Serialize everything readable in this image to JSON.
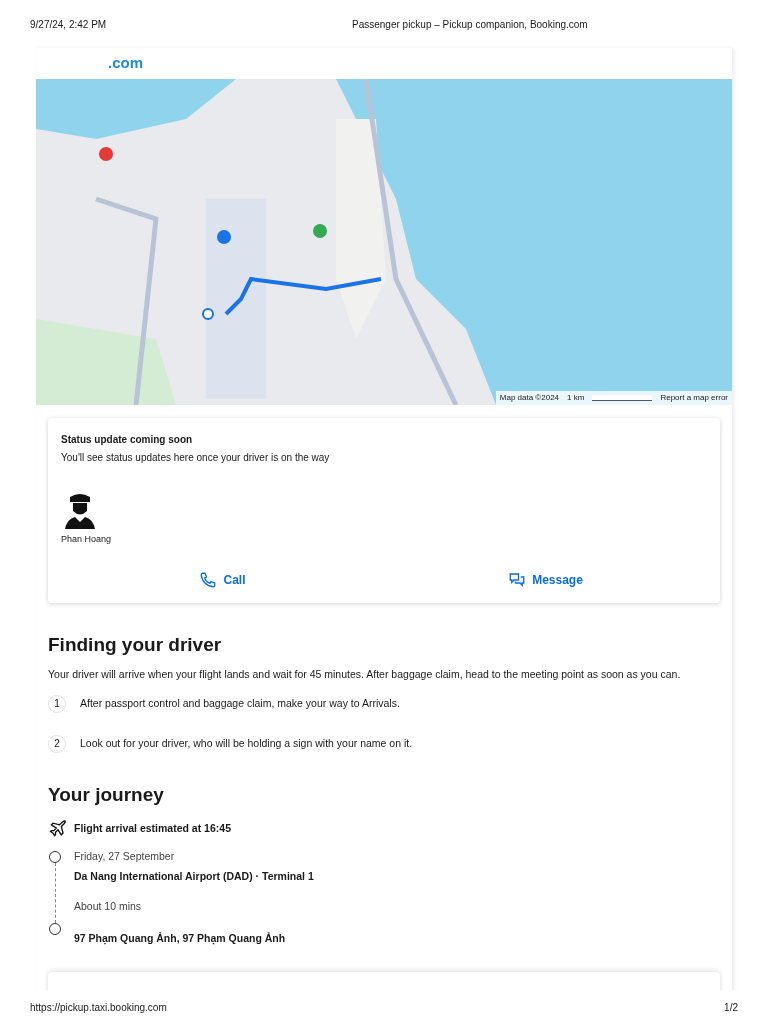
{
  "print_header": {
    "date": "9/27/24, 2:42 PM",
    "title": "Passenger pickup – Pickup companion, Booking.com"
  },
  "logo": {
    "text": ".com"
  },
  "map": {
    "kind": "picture",
    "attribution": "Map data ©2024",
    "scale": "1 km",
    "report": "Report a map error"
  },
  "status_card": {
    "title": "Status update coming soon",
    "text": "You'll see status updates here once your driver is on the way",
    "driver_name": "Phan Hoang",
    "actions": [
      {
        "kind": "call",
        "label": "Call"
      },
      {
        "kind": "message",
        "label": "Message"
      }
    ]
  },
  "finding": {
    "heading": "Finding your driver",
    "intro": "Your driver will arrive when your flight lands and wait for 45 minutes. After baggage claim, head to the meeting point as soon as you can.",
    "steps": [
      {
        "number": "1",
        "text": "After passport control and baggage claim, make your way to Arrivals."
      },
      {
        "number": "2",
        "text": "Look out for your driver, who will be holding a sign with your name on it."
      }
    ]
  },
  "journey": {
    "heading": "Your journey",
    "flight": "Flight arrival estimated at 16:45",
    "date": "Friday, 27 September",
    "origin": "Da Nang International Airport (DAD) · Terminal 1",
    "duration": "About 10 mins",
    "destination": "97 Phạm Quang Ảnh, 97 Phạm Quang Ảnh"
  },
  "print_footer": {
    "url": "https://pickup.taxi.booking.com",
    "page": "1/2"
  }
}
